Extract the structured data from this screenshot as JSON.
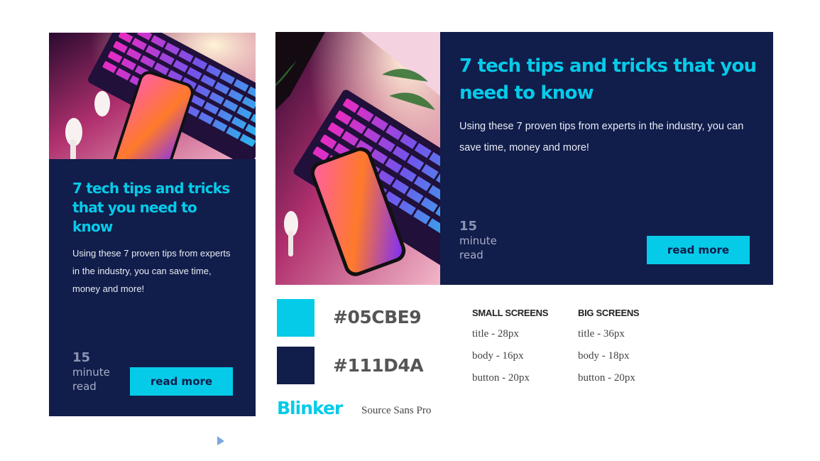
{
  "colors": {
    "accent": "#05CBE9",
    "navy": "#111D4A"
  },
  "card": {
    "title": "7 tech tips and tricks that you need to know",
    "body": "Using these 7 proven tips from experts in the industry, you can save time, money and more!",
    "read_time": "15",
    "read_unit_1": "minute",
    "read_unit_2": "read",
    "button": "read more"
  },
  "image": {
    "icon": "laptop-phone-photo"
  },
  "style_guide": {
    "swatches": [
      {
        "hex_label": "#05CBE9"
      },
      {
        "hex_label": "#111D4A"
      }
    ],
    "small_screens": {
      "heading": "SMALL SCREENS",
      "title": "title - 28px",
      "body": "body - 16px",
      "button": "button - 20px"
    },
    "big_screens": {
      "heading": "BIG SCREENS",
      "title": "title - 36px",
      "body": "body - 18px",
      "button": "button - 20px"
    },
    "fonts": {
      "heading_font": "Blinker",
      "body_font": "Source Sans Pro"
    }
  },
  "cursor": {
    "icon": "pointer-cursor-icon"
  }
}
